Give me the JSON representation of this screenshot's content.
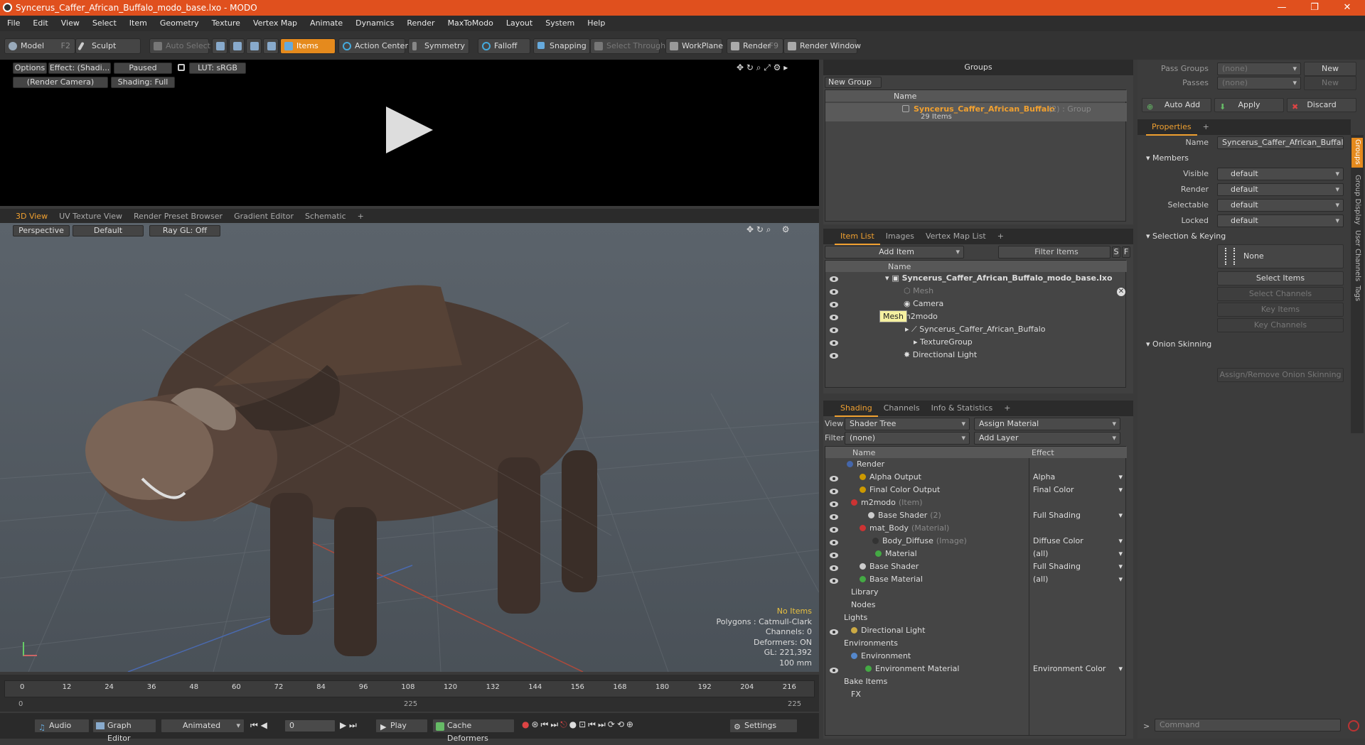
{
  "window": {
    "title": "Syncerus_Caffer_African_Buffalo_modo_base.lxo - MODO",
    "controls": [
      "—",
      "❐",
      "✕"
    ]
  },
  "menu": [
    "File",
    "Edit",
    "View",
    "Select",
    "Item",
    "Geometry",
    "Texture",
    "Vertex Map",
    "Animate",
    "Dynamics",
    "Render",
    "MaxToModo",
    "Layout",
    "System",
    "Help"
  ],
  "toolbar": {
    "model": "Model",
    "model_key": "F2",
    "sculpt": "Sculpt",
    "auto_select": "Auto Select",
    "items": "Items",
    "action_center": "Action Center",
    "symmetry": "Symmetry",
    "falloff": "Falloff",
    "snapping": "Snapping",
    "select_through": "Select Through",
    "workplane": "WorkPlane",
    "render": "Render",
    "render_key": "F9",
    "render_window": "Render Window"
  },
  "preview": {
    "options": "Options",
    "effect": "Effect: (Shadi...",
    "paused": "Paused",
    "lut": "LUT: sRGB",
    "camera": "(Render Camera)",
    "shading": "Shading: Full"
  },
  "viewport": {
    "tabs": [
      "3D View",
      "UV Texture View",
      "Render Preset Browser",
      "Gradient Editor",
      "Schematic",
      "+"
    ],
    "perspective": "Perspective",
    "default": "Default",
    "raygl": "Ray GL: Off",
    "stats": {
      "no_items": "No Items",
      "polygons": "Polygons : Catmull-Clark",
      "channels": "Channels: 0",
      "deformers": "Deformers: ON",
      "gl": "GL: 221,392",
      "unit": "100 mm"
    }
  },
  "timeline": {
    "ticks": [
      "0",
      "12",
      "24",
      "36",
      "48",
      "60",
      "72",
      "84",
      "96",
      "108",
      "120",
      "132",
      "144",
      "156",
      "168",
      "180",
      "192",
      "204",
      "216"
    ],
    "start": "0",
    "mid": "225",
    "end": "225"
  },
  "bottombar": {
    "audio": "Audio",
    "graph_editor": "Graph Editor",
    "animated": "Animated",
    "frame": "0",
    "play": "Play",
    "cache": "Cache Deformers",
    "settings": "Settings"
  },
  "groups": {
    "title": "Groups",
    "new_group": "New Group",
    "col_name": "Name",
    "item_name": "Syncerus_Caffer_African_Buffalo",
    "item_suffix": "(2) : Group",
    "item_count": "29 Items"
  },
  "itemlist": {
    "tabs": [
      "Item List",
      "Images",
      "Vertex Map List",
      "+"
    ],
    "add_item": "Add Item",
    "filter": "Filter Items",
    "s": "S",
    "f": "F",
    "col_name": "Name",
    "rows": [
      "Syncerus_Caffer_African_Buffalo_modo_base.lxo",
      "Mesh",
      "Camera",
      "m2modo",
      "Syncerus_Caffer_African_Buffalo",
      "TextureGroup",
      "Directional Light"
    ],
    "tooltip": "Mesh"
  },
  "shading": {
    "tabs": [
      "Shading",
      "Channels",
      "Info & Statistics",
      "+"
    ],
    "view_label": "View",
    "view": "Shader Tree",
    "assign": "Assign Material",
    "filter_label": "Filter",
    "filter": "(none)",
    "add_layer": "Add Layer",
    "col_name": "Name",
    "col_effect": "Effect",
    "rows": [
      {
        "name": "Render",
        "suffix": "",
        "effect": ""
      },
      {
        "name": "Alpha Output",
        "suffix": "",
        "effect": "Alpha"
      },
      {
        "name": "Final Color Output",
        "suffix": "",
        "effect": "Final Color"
      },
      {
        "name": "m2modo",
        "suffix": "(Item)",
        "effect": ""
      },
      {
        "name": "Base Shader",
        "suffix": "(2)",
        "effect": "Full Shading"
      },
      {
        "name": "mat_Body",
        "suffix": "(Material)",
        "effect": ""
      },
      {
        "name": "Body_Diffuse",
        "suffix": "(Image)",
        "effect": "Diffuse Color"
      },
      {
        "name": "Material",
        "suffix": "",
        "effect": "(all)"
      },
      {
        "name": "Base Shader",
        "suffix": "",
        "effect": "Full Shading"
      },
      {
        "name": "Base Material",
        "suffix": "",
        "effect": "(all)"
      },
      {
        "name": "Library",
        "suffix": "",
        "effect": ""
      },
      {
        "name": "Nodes",
        "suffix": "",
        "effect": ""
      },
      {
        "name": "Lights",
        "suffix": "",
        "effect": ""
      },
      {
        "name": "Directional Light",
        "suffix": "",
        "effect": ""
      },
      {
        "name": "Environments",
        "suffix": "",
        "effect": ""
      },
      {
        "name": "Environment",
        "suffix": "",
        "effect": ""
      },
      {
        "name": "Environment Material",
        "suffix": "",
        "effect": "Environment Color"
      },
      {
        "name": "Bake Items",
        "suffix": "",
        "effect": ""
      },
      {
        "name": "FX",
        "suffix": "",
        "effect": ""
      }
    ]
  },
  "right": {
    "pass_groups": "Pass Groups",
    "passes": "Passes",
    "none": "(none)",
    "new": "New",
    "auto_add": "Auto Add",
    "apply": "Apply",
    "discard": "Discard",
    "properties": "Properties",
    "name_label": "Name",
    "name_value": "Syncerus_Caffer_African_Buffalo",
    "members": "Members",
    "visible": "Visible",
    "render": "Render",
    "selectable": "Selectable",
    "locked": "Locked",
    "default": "default",
    "sel_keying": "Selection & Keying",
    "none_btn": "None",
    "select_items": "Select Items",
    "select_channels": "Select Channels",
    "key_items": "Key Items",
    "key_channels": "Key Channels",
    "onion": "Onion Skinning",
    "assign_onion": "Assign/Remove Onion Skinning",
    "side_tabs": [
      "Groups",
      "Group Display",
      "User Channels",
      "Tags"
    ],
    "command": "Command"
  }
}
